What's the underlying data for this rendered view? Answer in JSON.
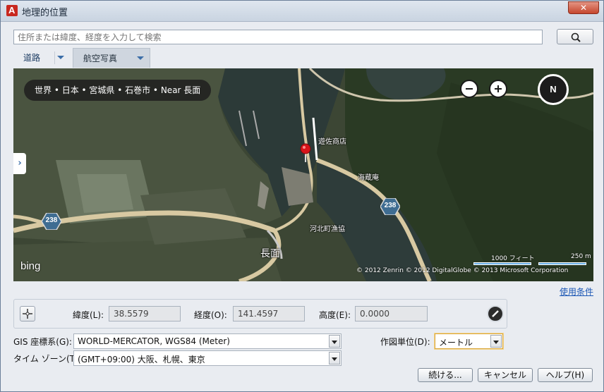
{
  "window": {
    "title": "地理的位置",
    "close_label": "✕"
  },
  "search": {
    "placeholder": "住所または緯度、経度を入力して検索"
  },
  "tabs": [
    {
      "label": "道路"
    },
    {
      "label": "航空写真"
    }
  ],
  "map": {
    "breadcrumb": "世界 • 日本 • 宮城県 • 石巻市 • Near 長面",
    "compass_label": "N",
    "collapse_arrow": "›",
    "route_badges": [
      "238",
      "238"
    ],
    "labels": {
      "shop": "遊佐商店",
      "kaizo": "海蔵庵",
      "fishery": "河北町漁協",
      "nagatsura": "長面"
    },
    "scale_feet": "1000 フィート",
    "scale_meters": "250 m",
    "brand": "bing",
    "copyright": "© 2012 Zenrin   © 2012 DigitalGlobe   © 2013 Microsoft Corporation"
  },
  "terms_link": "使用条件",
  "coords": {
    "latitude_label": "緯度(L):",
    "latitude_value": "38.5579",
    "longitude_label": "経度(O):",
    "longitude_value": "141.4597",
    "elevation_label": "高度(E):",
    "elevation_value": "0.0000"
  },
  "gis": {
    "label": "GIS 座標系(G):",
    "value": "WORLD-MERCATOR, WGS84 (Meter)"
  },
  "units": {
    "label": "作図単位(D):",
    "value": "メートル"
  },
  "timezone": {
    "label": "タイム ゾーン(T):",
    "value": "(GMT+09:00) 大阪、札幌、東京"
  },
  "buttons": {
    "continue": "続ける...",
    "cancel": "キャンセル",
    "help": "ヘルプ(H)"
  }
}
